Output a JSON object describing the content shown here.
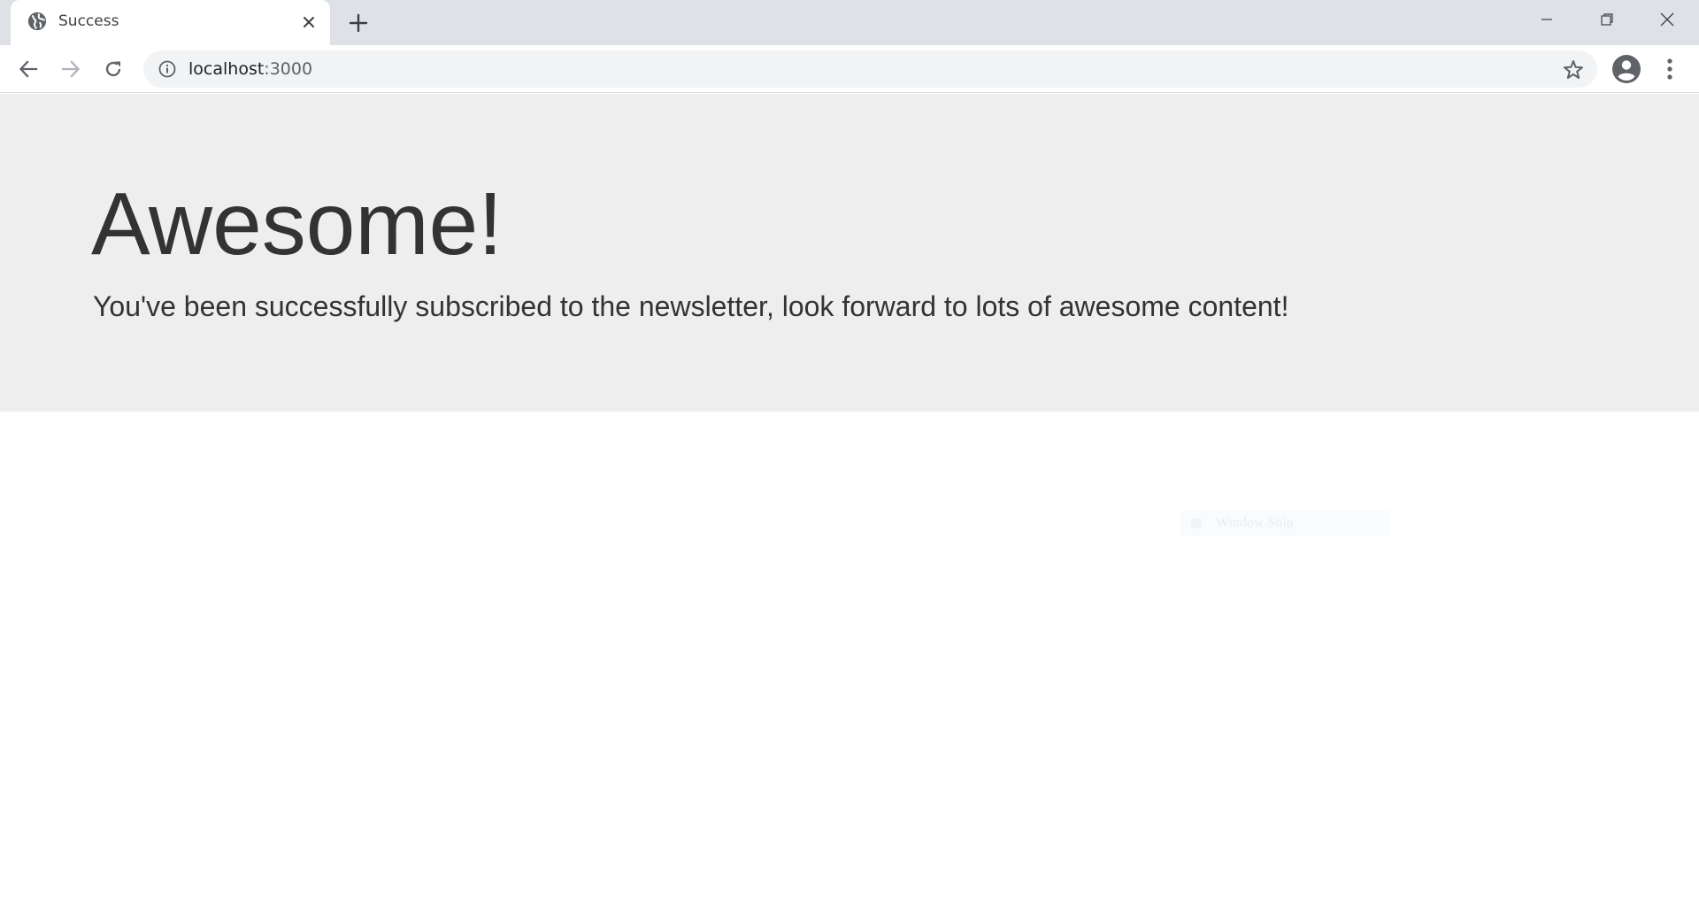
{
  "browser": {
    "tab": {
      "title": "Success",
      "favicon": "globe-icon",
      "close_icon": "close-icon"
    },
    "new_tab_icon": "plus-icon",
    "window_controls": {
      "minimize_icon": "minimize-icon",
      "restore_icon": "restore-icon",
      "close_icon": "close-icon"
    },
    "toolbar": {
      "back_icon": "arrow-left-icon",
      "forward_icon": "arrow-right-icon",
      "reload_icon": "reload-icon",
      "info_icon": "info-icon",
      "url_host": "localhost",
      "url_port": ":3000",
      "bookmark_icon": "star-icon",
      "profile_icon": "account-circle-icon",
      "menu_icon": "more-vert-icon"
    },
    "colors": {
      "tabstrip": "#dee1e6",
      "omnibox": "#f1f3f4",
      "icon": "#5f6368",
      "icon_disabled": "#b0b3b8"
    }
  },
  "page": {
    "heading": "Awesome!",
    "lead": "You've been successfully subscribed to the newsletter, look forward to lots of awesome content!",
    "colors": {
      "jumbotron_bg": "#eeeeee",
      "text": "#333333"
    }
  },
  "overlay": {
    "tooltip_text": "Window Snip"
  }
}
